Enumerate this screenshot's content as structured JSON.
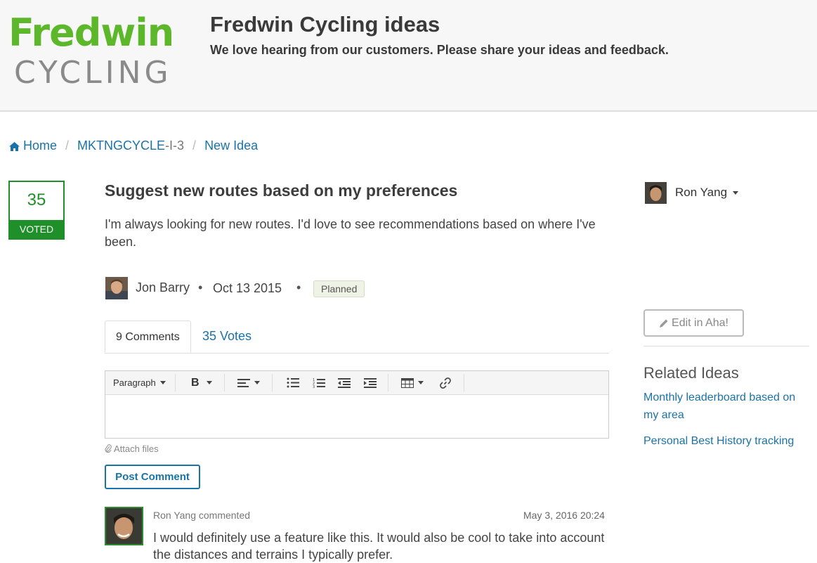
{
  "header": {
    "logo_line1": "Fredwin",
    "logo_line2": "CYCLING",
    "title": "Fredwin Cycling ideas",
    "subtitle": "We love hearing from our customers. Please share your ideas and feedback."
  },
  "breadcrumb": {
    "home": "Home",
    "idea_ref": "MKTNGCYCLE",
    "idea_ref_suffix": "-I-3",
    "current": "New Idea",
    "separator": "/"
  },
  "vote": {
    "count": "35",
    "label": "VOTED"
  },
  "idea": {
    "title": "Suggest new routes based on my preferences",
    "description": "I'm always looking for new routes. I'd love to see recommendations based on where I've been.",
    "author": "Jon Barry",
    "date": "Oct 13 2015",
    "status": "Planned"
  },
  "tabs": {
    "comments": "9 Comments",
    "votes": "35 Votes"
  },
  "editor": {
    "format": "Paragraph",
    "bold": "B",
    "attach": "Attach files",
    "post_button": "Post Comment"
  },
  "comment": {
    "author_line": "Ron Yang commented",
    "timestamp": "May 3, 2016 20:24",
    "body": "I would definitely use a feature like this. It would also be cool to take into account the distances and terrains I typically prefer."
  },
  "sidebar": {
    "user": "Ron Yang",
    "edit_button": "Edit in Aha!",
    "related_heading": "Related Ideas",
    "related": [
      "Monthly leaderboard based on my area",
      "Personal Best History tracking"
    ]
  },
  "colors": {
    "brand_green": "#5cb82a",
    "vote_green": "#1f8f2a",
    "link_blue": "#1a73a8"
  }
}
